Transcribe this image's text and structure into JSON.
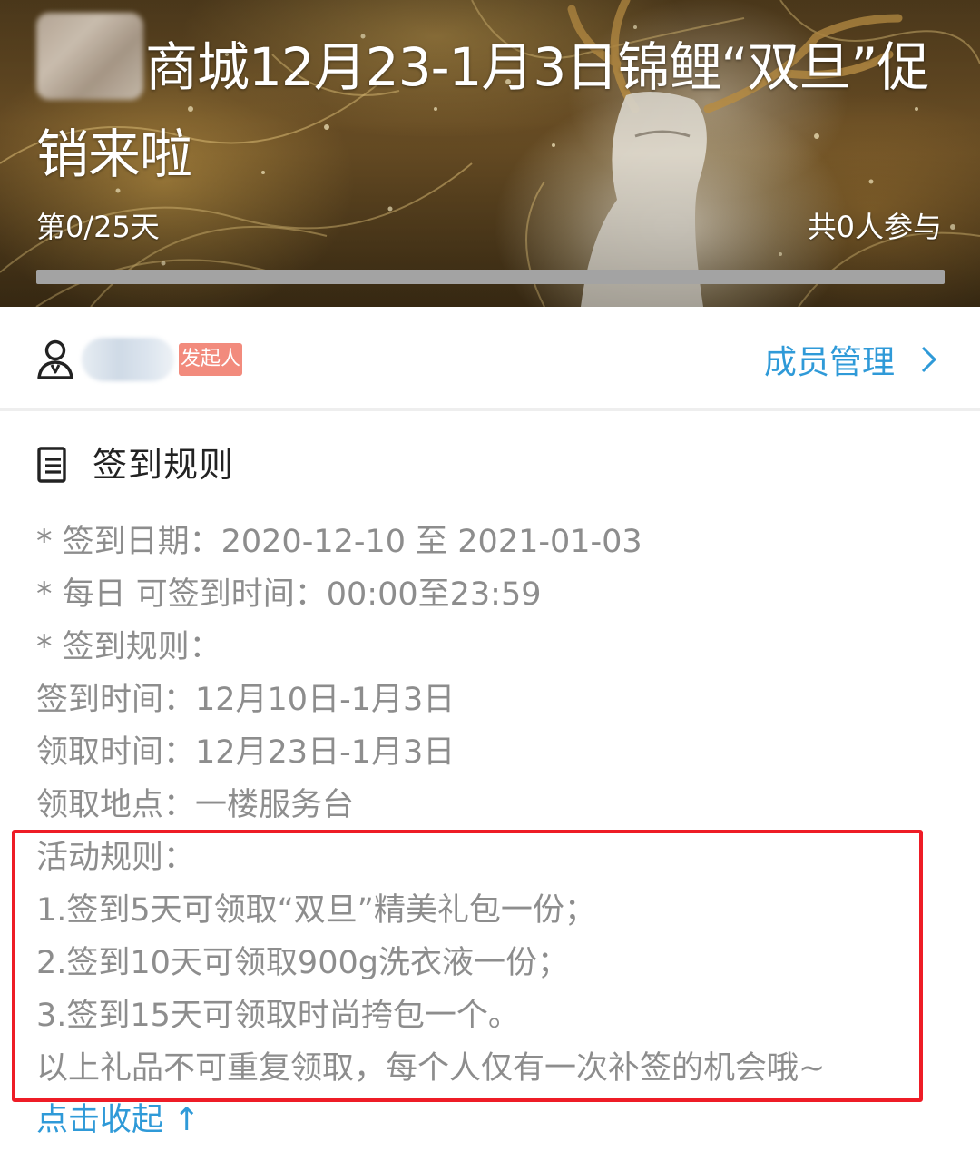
{
  "banner": {
    "title": "商城12月23-1月3日锦鲤“双旦”促销来啦",
    "progress_day": "第0/25天",
    "participants": "共0人参与",
    "progress_fraction": 0
  },
  "member": {
    "role_badge": "发起人",
    "manage_label": "成员管理"
  },
  "rules": {
    "title": "签到规则",
    "lines": [
      "* 签到日期：2020-12-10 至 2021-01-03",
      "* 每日 可签到时间：00:00至23:59",
      "* 签到规则：",
      "签到时间：12月10日-1月3日",
      "领取时间：12月23日-1月3日",
      "领取地点：一楼服务台",
      "活动规则：",
      "1.签到5天可领取“双旦”精美礼包一份；",
      "2.签到10天可领取900g洗衣液一份；",
      "3.签到15天可领取时尚挎包一个。",
      "以上礼品不可重复领取，每个人仅有一次补签的机会哦~"
    ],
    "collapse_label": "点击收起 ↑"
  },
  "colors": {
    "accent": "#2f9ad8",
    "badge": "#f28b7d",
    "highlight_border": "#ee1c26",
    "rule_text": "#8d8d8d"
  },
  "icons": [
    "person-icon",
    "document-icon",
    "chevron-right-icon"
  ]
}
